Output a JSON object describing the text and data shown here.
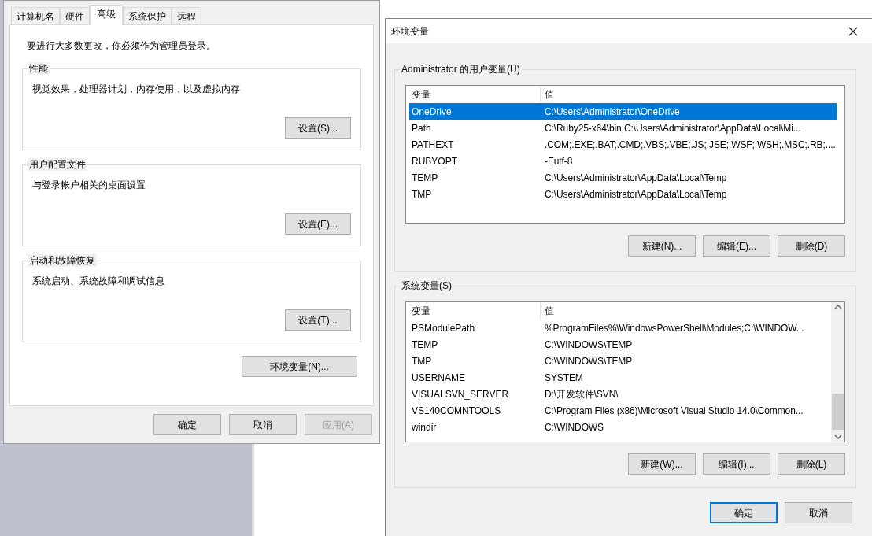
{
  "system_properties": {
    "tabs": [
      {
        "label": "计算机名",
        "selected": false
      },
      {
        "label": "硬件",
        "selected": false
      },
      {
        "label": "高级",
        "selected": true
      },
      {
        "label": "系统保护",
        "selected": false
      },
      {
        "label": "远程",
        "selected": false
      }
    ],
    "notice": "要进行大多数更改，你必须作为管理员登录。",
    "groups": [
      {
        "title": "性能",
        "description": "视觉效果，处理器计划，内存使用，以及虚拟内存",
        "button": "设置(S)..."
      },
      {
        "title": "用户配置文件",
        "description": "与登录帐户相关的桌面设置",
        "button": "设置(E)..."
      },
      {
        "title": "启动和故障恢复",
        "description": "系统启动、系统故障和调试信息",
        "button": "设置(T)..."
      }
    ],
    "env_button": "环境变量(N)...",
    "buttons": [
      {
        "label": "确定",
        "disabled": false
      },
      {
        "label": "取消",
        "disabled": false
      },
      {
        "label": "应用(A)",
        "disabled": true
      }
    ]
  },
  "env_dialog": {
    "title": "环境变量",
    "user_vars": {
      "title": "Administrator 的用户变量(U)",
      "columns": [
        "变量",
        "值"
      ],
      "rows": [
        {
          "name": "OneDrive",
          "value": "C:\\Users\\Administrator\\OneDrive",
          "selected": true
        },
        {
          "name": "Path",
          "value": "C:\\Ruby25-x64\\bin;C:\\Users\\Administrator\\AppData\\Local\\Mi...",
          "selected": false
        },
        {
          "name": "PATHEXT",
          "value": ".COM;.EXE;.BAT;.CMD;.VBS;.VBE;.JS;.JSE;.WSF;.WSH;.MSC;.RB;....",
          "selected": false
        },
        {
          "name": "RUBYOPT",
          "value": "-Eutf-8",
          "selected": false
        },
        {
          "name": "TEMP",
          "value": "C:\\Users\\Administrator\\AppData\\Local\\Temp",
          "selected": false
        },
        {
          "name": "TMP",
          "value": "C:\\Users\\Administrator\\AppData\\Local\\Temp",
          "selected": false
        }
      ],
      "buttons": [
        "新建(N)...",
        "编辑(E)...",
        "删除(D)"
      ]
    },
    "system_vars": {
      "title": "系统变量(S)",
      "columns": [
        "变量",
        "值"
      ],
      "rows": [
        {
          "name": "PSModulePath",
          "value": "%ProgramFiles%\\WindowsPowerShell\\Modules;C:\\WINDOW...",
          "selected": false
        },
        {
          "name": "TEMP",
          "value": "C:\\WINDOWS\\TEMP",
          "selected": false
        },
        {
          "name": "TMP",
          "value": "C:\\WINDOWS\\TEMP",
          "selected": false
        },
        {
          "name": "USERNAME",
          "value": "SYSTEM",
          "selected": false
        },
        {
          "name": "VISUALSVN_SERVER",
          "value": "D:\\开发软件\\SVN\\",
          "selected": false
        },
        {
          "name": "VS140COMNTOOLS",
          "value": "C:\\Program Files (x86)\\Microsoft Visual Studio 14.0\\Common...",
          "selected": false
        },
        {
          "name": "windir",
          "value": "C:\\WINDOWS",
          "selected": false
        }
      ],
      "buttons": [
        "新建(W)...",
        "编辑(I)...",
        "删除(L)"
      ]
    },
    "buttons": [
      {
        "label": "确定",
        "default": true
      },
      {
        "label": "取消",
        "default": false
      }
    ]
  }
}
